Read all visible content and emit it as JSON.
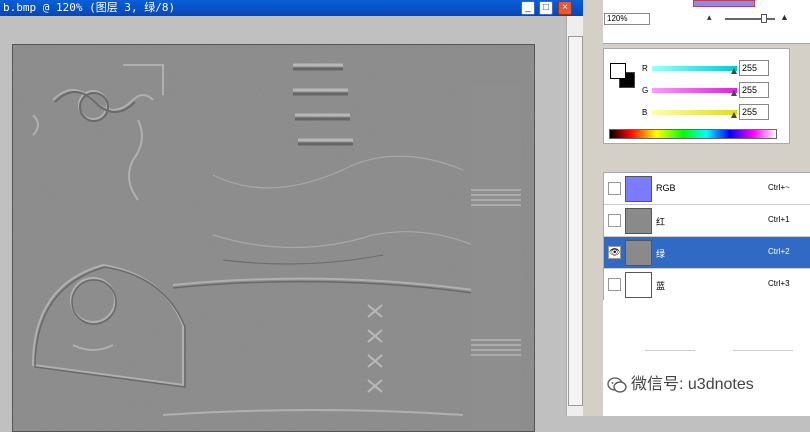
{
  "window": {
    "title": "b.bmp @ 120% (图层 3, 绿/8)",
    "minimize_glyph": "_",
    "maximize_glyph": "□",
    "close_glyph": "×"
  },
  "navigator": {
    "zoom": "120%"
  },
  "color": {
    "channels": [
      {
        "label": "R",
        "value": "255",
        "color": "#00cccc"
      },
      {
        "label": "G",
        "value": "255",
        "color": "#dd22dd"
      },
      {
        "label": "B",
        "value": "255",
        "color": "#dddd22"
      }
    ]
  },
  "channels_panel": {
    "rows": [
      {
        "name": "RGB",
        "shortcut": "Ctrl+~",
        "thumb_color": "#7b7bff",
        "visible": false,
        "selected": false
      },
      {
        "name": "红",
        "shortcut": "Ctrl+1",
        "thumb_color": "#8a8a8a",
        "visible": false,
        "selected": false
      },
      {
        "name": "绿",
        "shortcut": "Ctrl+2",
        "thumb_color": "#8a8a8a",
        "visible": true,
        "selected": true
      },
      {
        "name": "蓝",
        "shortcut": "Ctrl+3",
        "thumb_color": "#ffffff",
        "visible": false,
        "selected": false
      }
    ]
  },
  "watermark": {
    "text": "微信号: u3dnotes"
  },
  "colors": {
    "selection": "#316ac5",
    "titlebar": "#0a5fd8",
    "canvas": "#8a8a8a"
  }
}
